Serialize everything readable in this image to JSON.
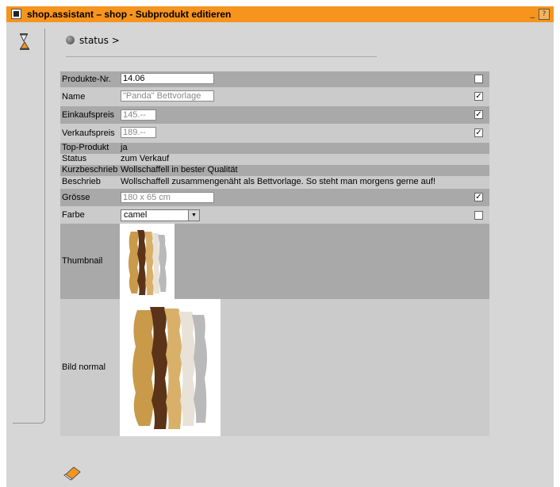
{
  "window": {
    "title": "shop.assistant – shop - Subprodukt editieren",
    "minimize": "_",
    "help": "?"
  },
  "breadcrumb": {
    "text": "status >"
  },
  "form": {
    "produkt_nr": {
      "label": "Produkte-Nr.",
      "value": "14.06",
      "checked": false
    },
    "name": {
      "label": "Name",
      "value": "\"Panda\" Bettvorlage",
      "checked": true
    },
    "einkaufspreis": {
      "label": "Einkaufspreis",
      "value": "145.--",
      "checked": true
    },
    "verkaufspreis": {
      "label": "Verkaufspreis",
      "value": "189.--",
      "checked": true
    },
    "top_produkt": {
      "label": "Top-Produkt",
      "value": "ja"
    },
    "status": {
      "label": "Status",
      "value": "zum Verkauf"
    },
    "kurzbeschrieb": {
      "label": "Kurzbeschrieb",
      "value": "Wollschaffell in bester Qualität"
    },
    "beschrieb": {
      "label": "Beschrieb",
      "value": "Wollschaffell zusammengenäht als Bettvorlage. So steht man morgens gerne auf!"
    },
    "groesse": {
      "label": "Grösse",
      "value": "180 x 65 cm",
      "checked": true
    },
    "farbe": {
      "label": "Farbe",
      "value": "camel",
      "checked": false
    },
    "thumbnail": {
      "label": "Thumbnail"
    },
    "bild_normal": {
      "label": "Bild normal"
    }
  },
  "checkmark": "✓",
  "icons": {
    "side": "hourglass-icon",
    "status": "status-dot-icon",
    "bottom": "edit-eraser-icon"
  }
}
